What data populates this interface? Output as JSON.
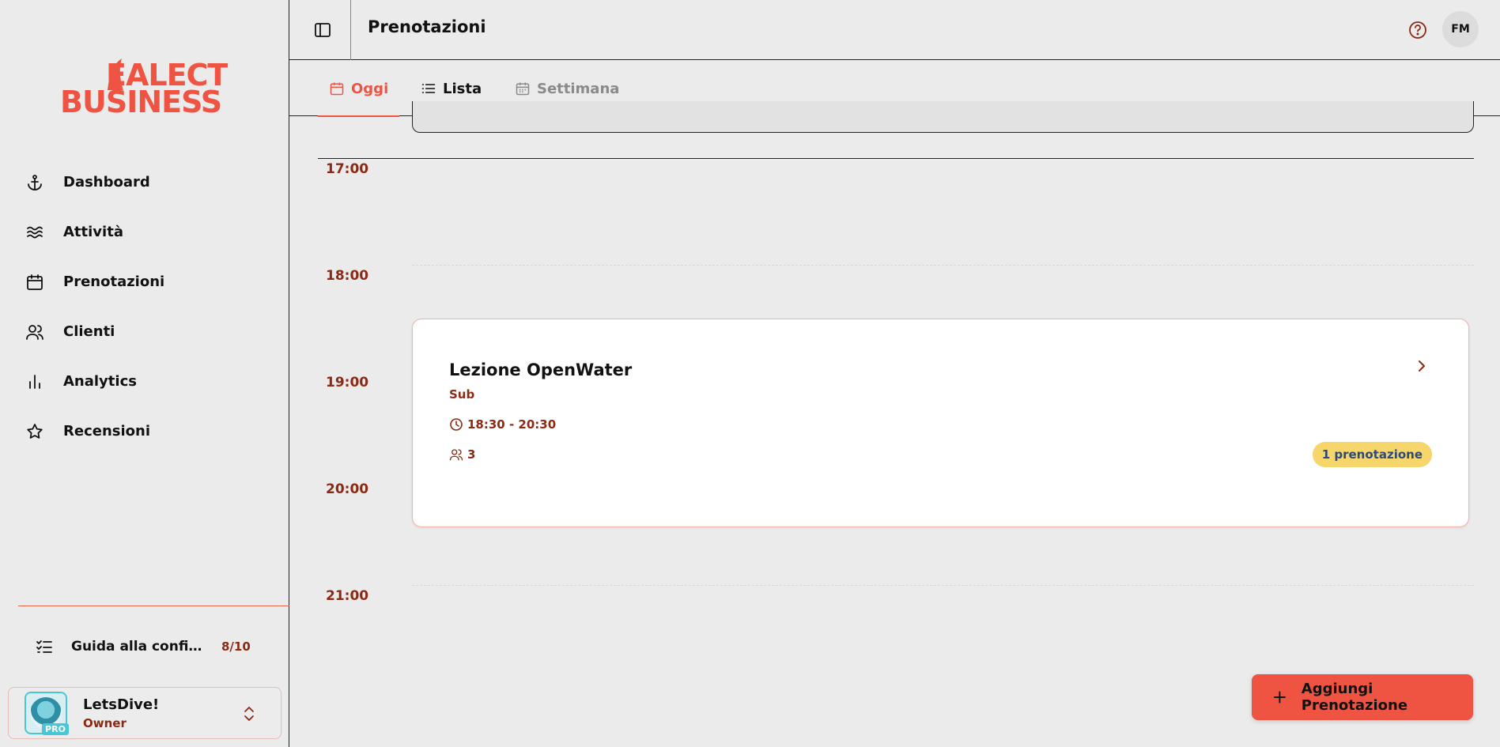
{
  "brand": {
    "logo_line1": "EALECT",
    "logo_line2": "BUSINESS",
    "accent_color": "#ef5443"
  },
  "sidebar": {
    "items": [
      {
        "label": "Dashboard",
        "icon": "anchor-icon"
      },
      {
        "label": "Attività",
        "icon": "waves-icon"
      },
      {
        "label": "Prenotazioni",
        "icon": "calendar-icon"
      },
      {
        "label": "Clienti",
        "icon": "users-icon"
      },
      {
        "label": "Analytics",
        "icon": "bar-chart-icon"
      },
      {
        "label": "Recensioni",
        "icon": "star-icon"
      }
    ],
    "guide": {
      "label": "Guida alla configurazione",
      "count": "8/10"
    },
    "account": {
      "name": "LetsDive!",
      "role": "Owner",
      "badge": "PRO"
    }
  },
  "header": {
    "title": "Prenotazioni",
    "avatar_initials": "FM"
  },
  "tabs": [
    {
      "label": "Oggi",
      "active": true
    },
    {
      "label": "Lista",
      "active": false
    },
    {
      "label": "Settimana",
      "active": false
    }
  ],
  "timeline": {
    "hours": [
      "17:00",
      "18:00",
      "19:00",
      "20:00",
      "21:00"
    ],
    "event": {
      "title": "Lezione OpenWater",
      "category": "Sub",
      "time": "18:30 - 20:30",
      "participants": "3",
      "badge": "1 prenotazione"
    }
  },
  "fab": {
    "label": "Aggiungi Prenotazione"
  }
}
